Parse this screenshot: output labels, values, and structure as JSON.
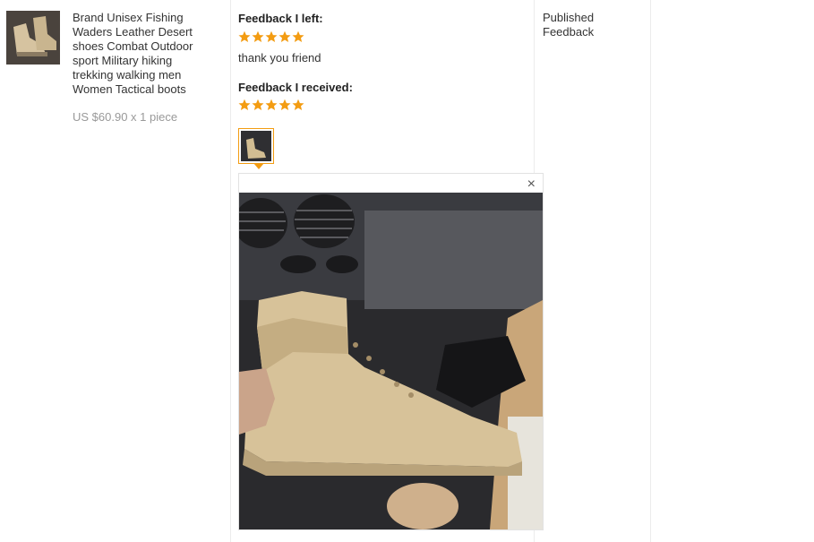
{
  "order": {
    "product": {
      "title": "Brand Unisex Fishing Waders Leather Desert shoes Combat Outdoor sport Military hiking trekking walking men Women Tactical boots",
      "price": "US $60.90 x 1 piece",
      "thumbnail_icon": "boot-thumbnail"
    },
    "feedback_left": {
      "label": "Feedback I left:",
      "stars": 5,
      "comment": "thank you friend"
    },
    "feedback_received": {
      "label": "Feedback I received:",
      "stars": 5
    },
    "photo_popup": {
      "close_symbol": "×",
      "photo_icon": "boot-photo"
    },
    "status": "Published Feedback"
  },
  "colors": {
    "star": "#f39c12",
    "thumb_border": "#f39c12",
    "divider": "#ececec"
  }
}
